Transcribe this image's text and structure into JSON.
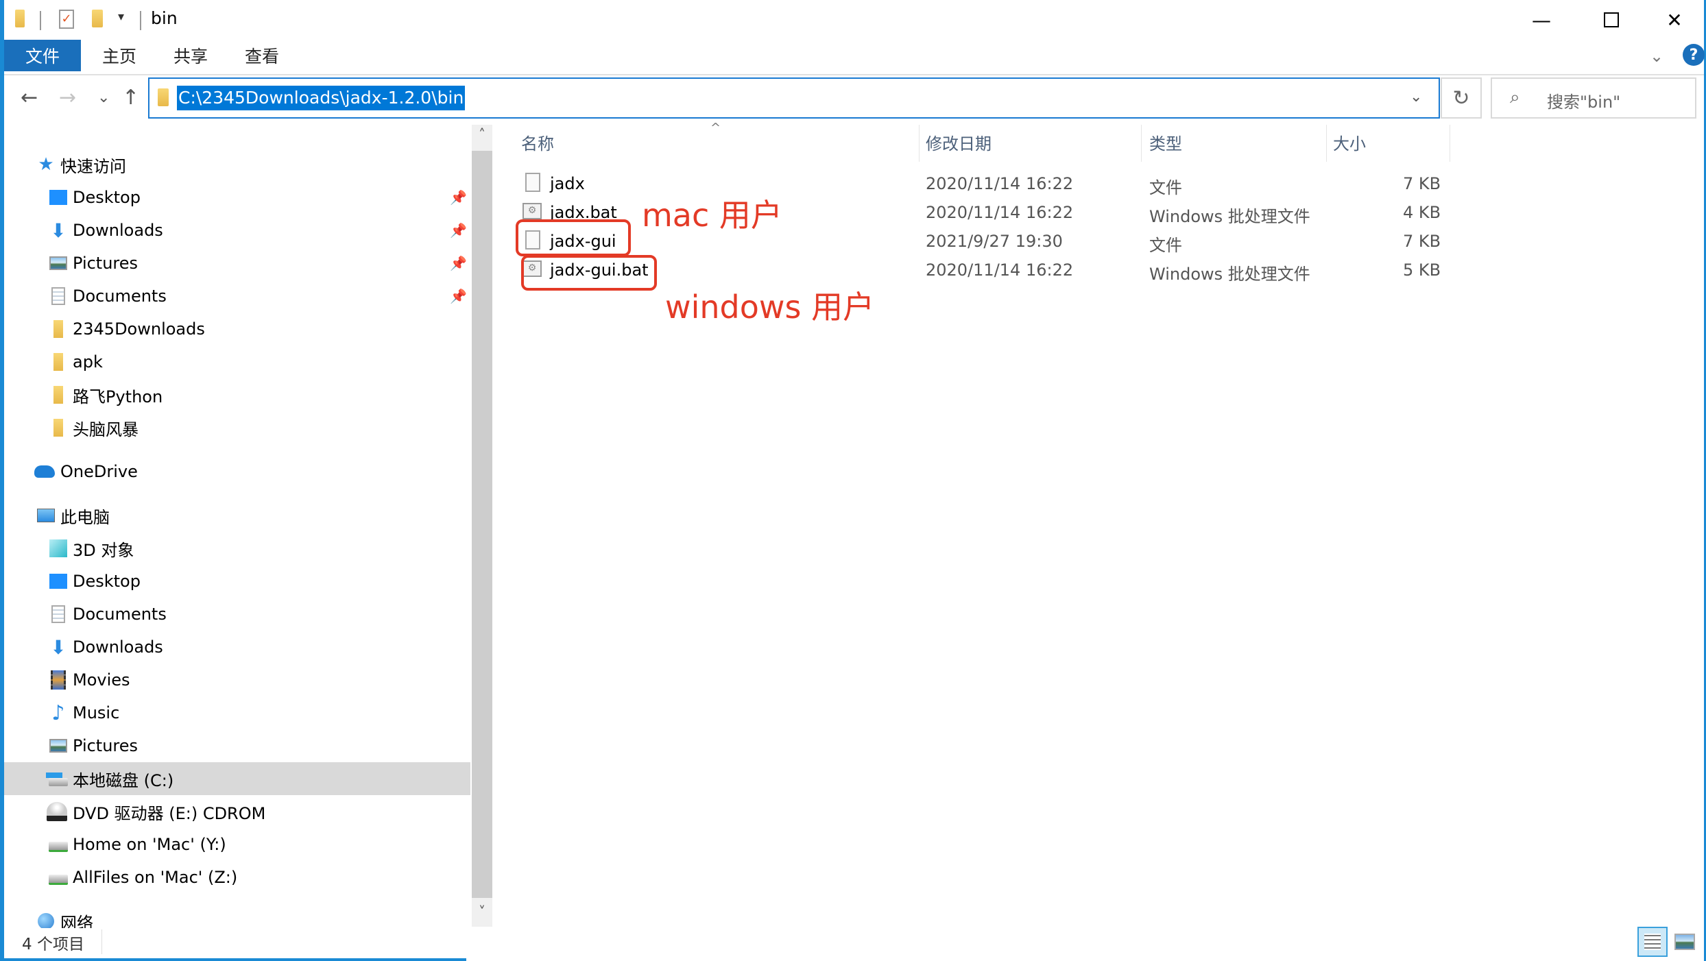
{
  "window": {
    "title": "bin",
    "minimize_icon": "minimize-icon",
    "maximize_icon": "maximize-icon",
    "close_icon": "close-icon"
  },
  "ribbon": {
    "tabs": [
      {
        "label": "文件",
        "active": true
      },
      {
        "label": "主页",
        "active": false
      },
      {
        "label": "共享",
        "active": false
      },
      {
        "label": "查看",
        "active": false
      }
    ],
    "help_label": "?"
  },
  "navigation": {
    "back": "←",
    "forward": "→",
    "recent": "⌄",
    "up": "↑",
    "address": "C:\\2345Downloads\\jadx-1.2.0\\bin",
    "refresh": "↻",
    "search_placeholder": "搜索\"bin\"",
    "search_icon": "⚲"
  },
  "sidebar": {
    "quick_access": {
      "label": "快速访问",
      "items": [
        {
          "label": "Desktop",
          "icon": "desktop-icon",
          "pinned": true
        },
        {
          "label": "Downloads",
          "icon": "downloads-icon",
          "pinned": true
        },
        {
          "label": "Pictures",
          "icon": "pictures-icon",
          "pinned": true
        },
        {
          "label": "Documents",
          "icon": "documents-icon",
          "pinned": true
        },
        {
          "label": "2345Downloads",
          "icon": "folder-icon",
          "pinned": false
        },
        {
          "label": "apk",
          "icon": "folder-icon",
          "pinned": false
        },
        {
          "label": "路飞Python",
          "icon": "folder-icon",
          "pinned": false
        },
        {
          "label": "头脑风暴",
          "icon": "folder-icon",
          "pinned": false
        }
      ]
    },
    "onedrive": {
      "label": "OneDrive"
    },
    "this_pc": {
      "label": "此电脑",
      "items": [
        {
          "label": "3D 对象",
          "icon": "3d-objects-icon"
        },
        {
          "label": "Desktop",
          "icon": "desktop-icon"
        },
        {
          "label": "Documents",
          "icon": "documents-icon"
        },
        {
          "label": "Downloads",
          "icon": "downloads-icon"
        },
        {
          "label": "Movies",
          "icon": "movies-icon"
        },
        {
          "label": "Music",
          "icon": "music-icon"
        },
        {
          "label": "Pictures",
          "icon": "pictures-icon"
        },
        {
          "label": "本地磁盘 (C:)",
          "icon": "local-disk-icon",
          "selected": true
        },
        {
          "label": "DVD 驱动器 (E:) CDROM",
          "icon": "dvd-drive-icon"
        },
        {
          "label": "Home on 'Mac' (Y:)",
          "icon": "network-drive-icon"
        },
        {
          "label": "AllFiles on 'Mac' (Z:)",
          "icon": "network-drive-icon"
        }
      ]
    },
    "network": {
      "label": "网络"
    }
  },
  "file_list": {
    "columns": [
      "名称",
      "修改日期",
      "类型",
      "大小"
    ],
    "sort_column": "名称",
    "rows": [
      {
        "name": "jadx",
        "modified": "2020/11/14 16:22",
        "type": "文件",
        "size": "7 KB",
        "icon": "file-icon"
      },
      {
        "name": "jadx.bat",
        "modified": "2020/11/14 16:22",
        "type": "Windows 批处理文件",
        "size": "4 KB",
        "icon": "batch-file-icon"
      },
      {
        "name": "jadx-gui",
        "modified": "2021/9/27 19:30",
        "type": "文件",
        "size": "7 KB",
        "icon": "file-icon"
      },
      {
        "name": "jadx-gui.bat",
        "modified": "2020/11/14 16:22",
        "type": "Windows 批处理文件",
        "size": "5 KB",
        "icon": "batch-file-icon"
      }
    ]
  },
  "annotations": {
    "mac": "mac 用户",
    "windows": "windows 用户",
    "color": "#e33a26"
  },
  "status_bar": {
    "item_count": "4 个项目"
  }
}
